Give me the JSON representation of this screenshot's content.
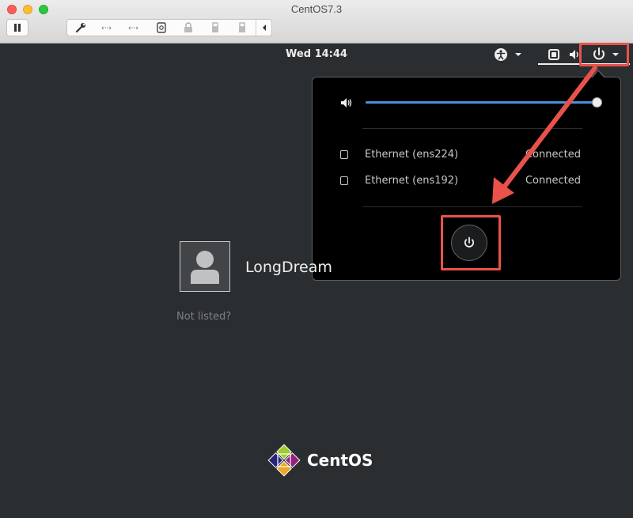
{
  "window": {
    "title": "CentOS7.3"
  },
  "toolbar": {
    "icons": [
      "pause-icon",
      "wrench-icon",
      "network-arrows-icon",
      "network-arrows-icon",
      "disk-icon",
      "lock-icon",
      "usb-icon",
      "usb-icon",
      "chevron-left-icon"
    ]
  },
  "topbar": {
    "clock": "Wed 14:44",
    "icons": [
      "accessibility-icon",
      "network-icon",
      "volume-icon",
      "power-icon"
    ]
  },
  "system_menu": {
    "volume_level": 1.0,
    "network": [
      {
        "name": "Ethernet (ens224)",
        "status": "Connected"
      },
      {
        "name": "Ethernet (ens192)",
        "status": "Connected"
      }
    ]
  },
  "login": {
    "username": "LongDream",
    "not_listed": "Not listed?"
  },
  "brand": {
    "name": "CentOS"
  },
  "colors": {
    "background": "#2b2e31",
    "accent_blue": "#4a90d9",
    "annotation_red": "#e8524a"
  }
}
